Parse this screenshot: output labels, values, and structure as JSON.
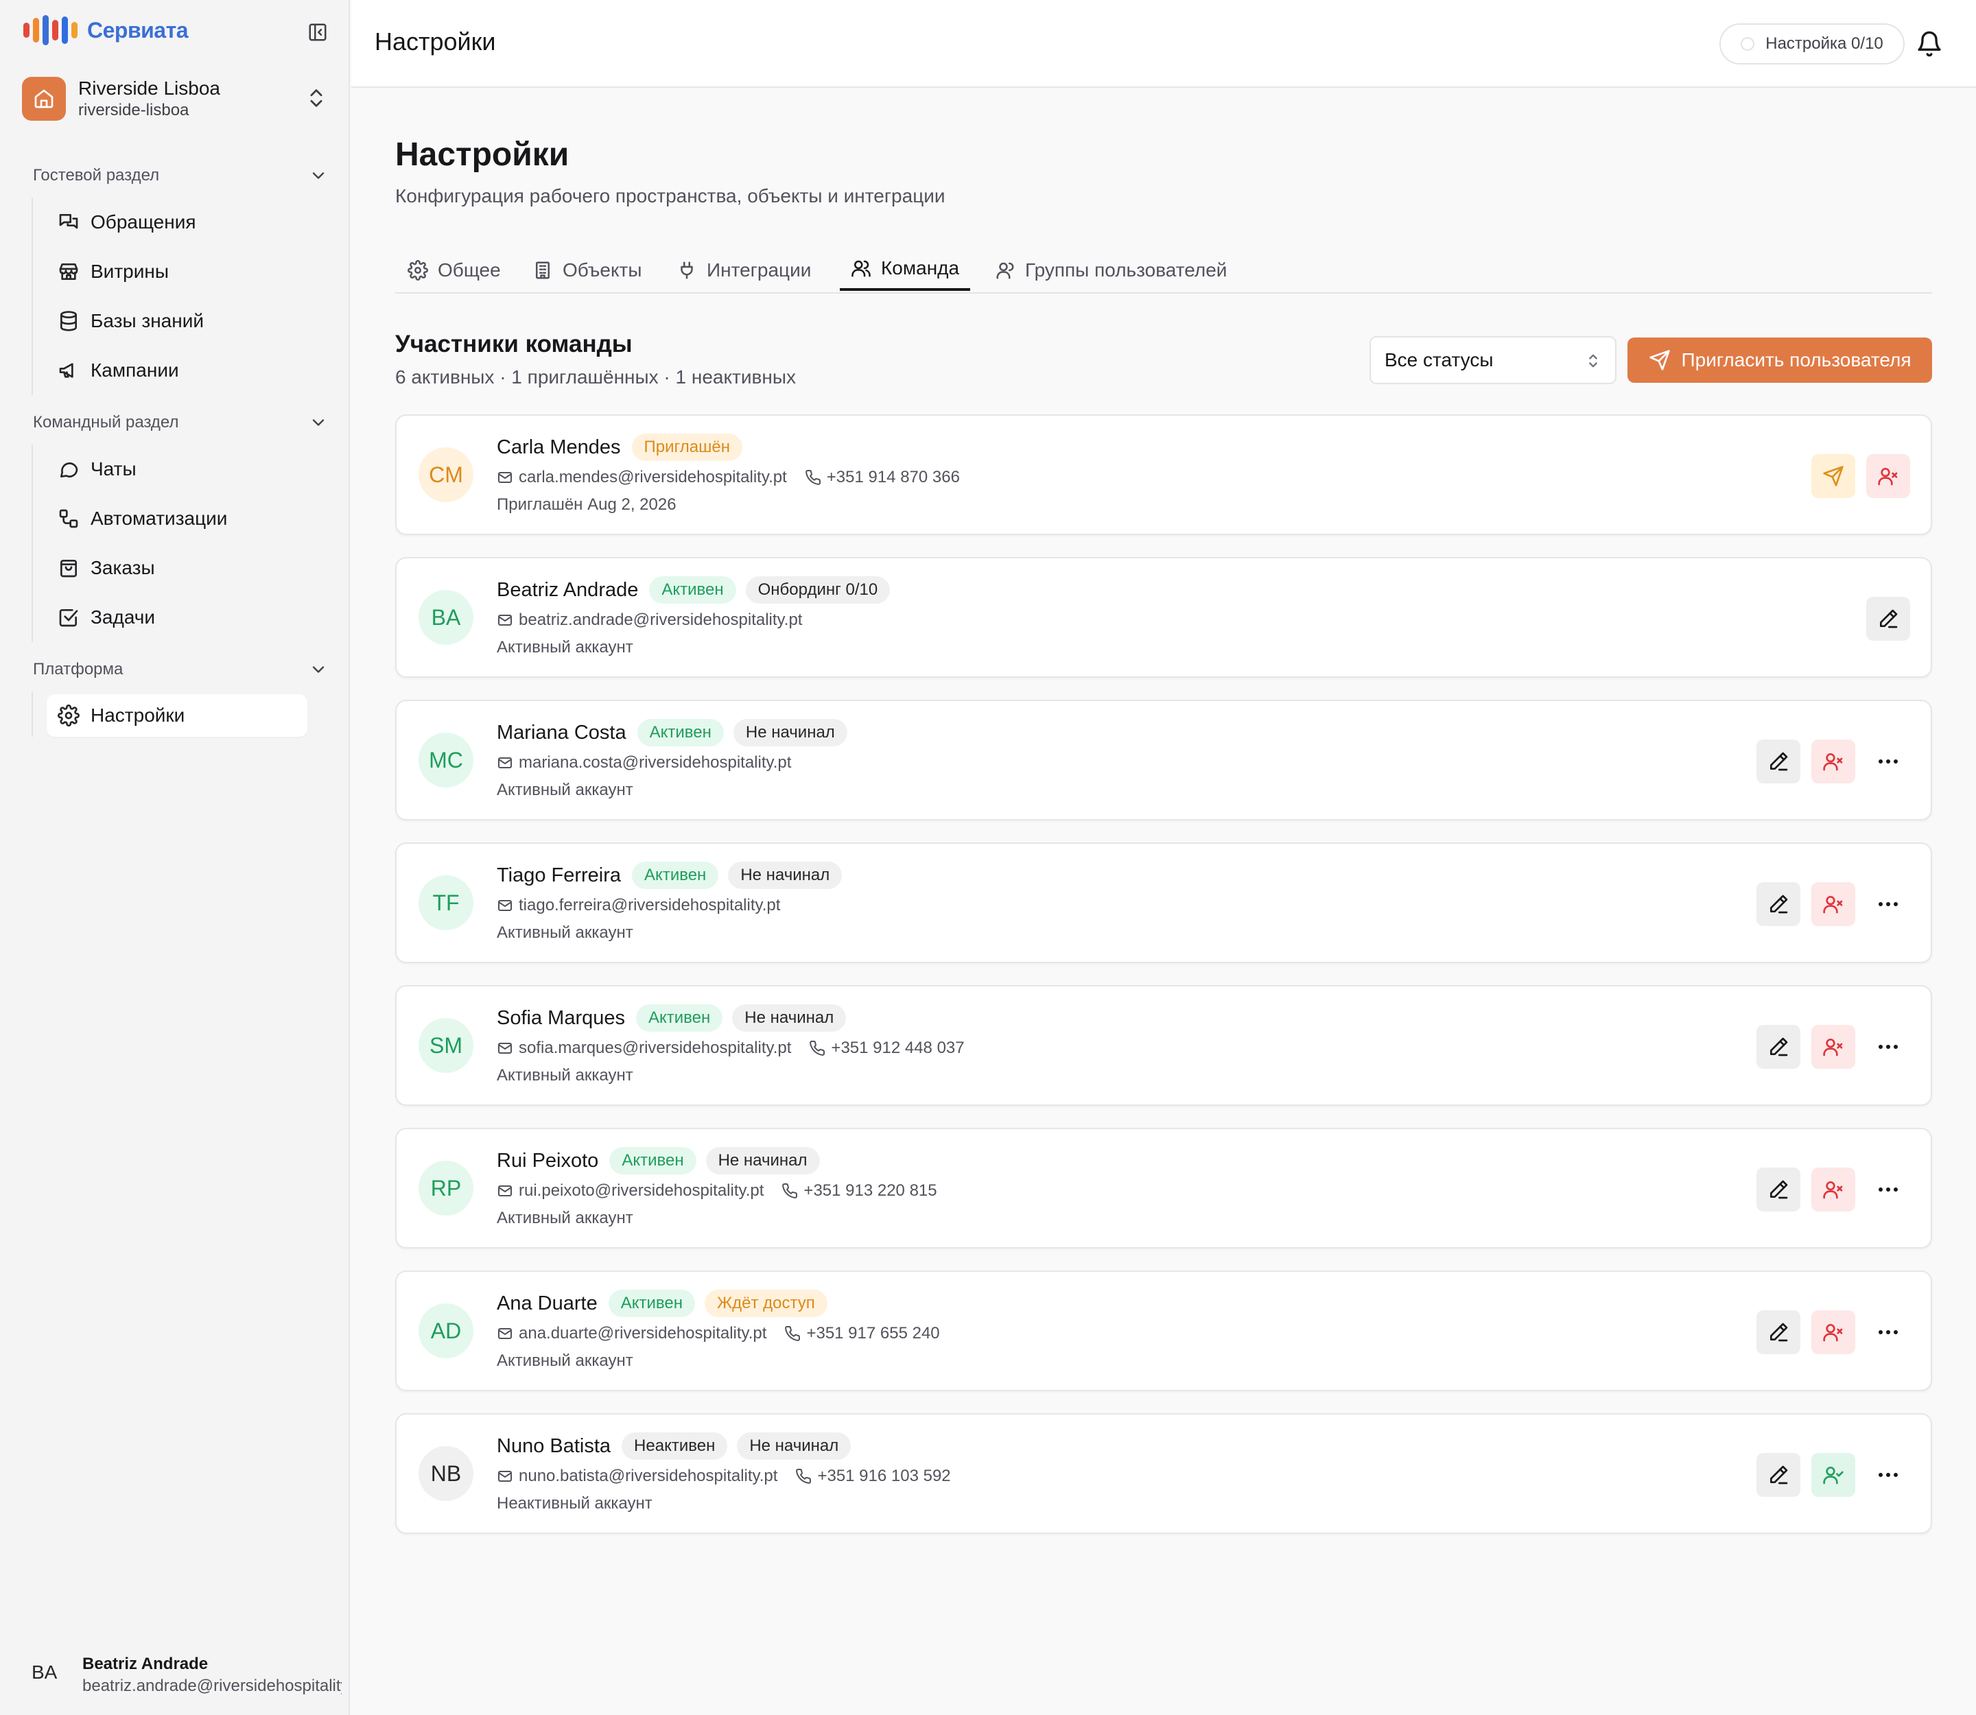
{
  "app": {
    "brand": "Сервиата",
    "brand_colors": [
      "#e24a3b",
      "#f28a2c",
      "#3b6fd6",
      "#e24a3b",
      "#2f6ee0",
      "#f0a030"
    ]
  },
  "workspace": {
    "name": "Riverside Lisboa",
    "slug": "riverside-lisboa"
  },
  "sidebar": {
    "sections": [
      {
        "title": "Гостевой раздел",
        "items": [
          {
            "label": "Обращения",
            "icon": "messages-icon"
          },
          {
            "label": "Витрины",
            "icon": "store-icon"
          },
          {
            "label": "Базы знаний",
            "icon": "database-icon"
          },
          {
            "label": "Кампании",
            "icon": "megaphone-icon"
          }
        ]
      },
      {
        "title": "Командный раздел",
        "items": [
          {
            "label": "Чаты",
            "icon": "chat-icon"
          },
          {
            "label": "Автоматизации",
            "icon": "workflow-icon"
          },
          {
            "label": "Заказы",
            "icon": "shopping-bag-icon"
          },
          {
            "label": "Задачи",
            "icon": "checkbox-icon"
          }
        ]
      },
      {
        "title": "Платформа",
        "items": [
          {
            "label": "Настройки",
            "icon": "gear-icon",
            "active": true
          }
        ]
      }
    ]
  },
  "user": {
    "initials": "BA",
    "name": "Beatriz Andrade",
    "email": "beatriz.andrade@riversidehospitality.pt"
  },
  "topbar": {
    "title": "Настройки",
    "setup_label": "Настройка 0/10"
  },
  "page": {
    "title": "Настройки",
    "subtitle": "Конфигурация рабочего пространства, объекты и интеграции"
  },
  "tabs": [
    {
      "label": "Общее",
      "icon": "gear-icon"
    },
    {
      "label": "Объекты",
      "icon": "building-icon"
    },
    {
      "label": "Интеграции",
      "icon": "plug-icon"
    },
    {
      "label": "Команда",
      "icon": "users-icon",
      "active": true
    },
    {
      "label": "Группы пользователей",
      "icon": "user-group-icon"
    }
  ],
  "team": {
    "title": "Участники команды",
    "stats": "6 активных · 1 приглашённых · 1 неактивных",
    "filter_value": "Все статусы",
    "invite_label": "Пригласить пользователя"
  },
  "members": [
    {
      "initials": "CM",
      "name": "Carla Mendes",
      "badges": [
        {
          "text": "Приглашён",
          "tone": "orange"
        }
      ],
      "email": "carla.mendes@riversidehospitality.pt",
      "phone": "+351 914 870 366",
      "note": "Приглашён Aug 2, 2026",
      "actions": [
        "resend",
        "remove"
      ],
      "avatar_bg": "#fff1dc",
      "avatar_fg": "#dc8a1a"
    },
    {
      "initials": "BA",
      "name": "Beatriz Andrade",
      "badges": [
        {
          "text": "Активен",
          "tone": "green"
        },
        {
          "text": "Онбординг 0/10",
          "tone": "gray"
        }
      ],
      "email": "beatriz.andrade@riversidehospitality.pt",
      "phone": "",
      "note": "Активный аккаунт",
      "actions": [
        "edit"
      ],
      "avatar_bg": "#e4f8ee",
      "avatar_fg": "#1f9d5b"
    },
    {
      "initials": "MC",
      "name": "Mariana Costa",
      "badges": [
        {
          "text": "Активен",
          "tone": "green"
        },
        {
          "text": "Не начинал",
          "tone": "gray"
        }
      ],
      "email": "mariana.costa@riversidehospitality.pt",
      "phone": "",
      "note": "Активный аккаунт",
      "actions": [
        "edit",
        "remove",
        "more"
      ],
      "avatar_bg": "#e4f8ee",
      "avatar_fg": "#1f9d5b"
    },
    {
      "initials": "TF",
      "name": "Tiago Ferreira",
      "badges": [
        {
          "text": "Активен",
          "tone": "green"
        },
        {
          "text": "Не начинал",
          "tone": "gray"
        }
      ],
      "email": "tiago.ferreira@riversidehospitality.pt",
      "phone": "",
      "note": "Активный аккаунт",
      "actions": [
        "edit",
        "remove",
        "more"
      ],
      "avatar_bg": "#e4f8ee",
      "avatar_fg": "#1f9d5b"
    },
    {
      "initials": "SM",
      "name": "Sofia Marques",
      "badges": [
        {
          "text": "Активен",
          "tone": "green"
        },
        {
          "text": "Не начинал",
          "tone": "gray"
        }
      ],
      "email": "sofia.marques@riversidehospitality.pt",
      "phone": "+351 912 448 037",
      "note": "Активный аккаунт",
      "actions": [
        "edit",
        "remove",
        "more"
      ],
      "avatar_bg": "#e4f8ee",
      "avatar_fg": "#1f9d5b"
    },
    {
      "initials": "RP",
      "name": "Rui Peixoto",
      "badges": [
        {
          "text": "Активен",
          "tone": "green"
        },
        {
          "text": "Не начинал",
          "tone": "gray"
        }
      ],
      "email": "rui.peixoto@riversidehospitality.pt",
      "phone": "+351 913 220 815",
      "note": "Активный аккаунт",
      "actions": [
        "edit",
        "remove",
        "more"
      ],
      "avatar_bg": "#e4f8ee",
      "avatar_fg": "#1f9d5b"
    },
    {
      "initials": "AD",
      "name": "Ana Duarte",
      "badges": [
        {
          "text": "Активен",
          "tone": "green"
        },
        {
          "text": "Ждёт доступ",
          "tone": "orange"
        }
      ],
      "email": "ana.duarte@riversidehospitality.pt",
      "phone": "+351 917 655 240",
      "note": "Активный аккаунт",
      "actions": [
        "edit",
        "remove",
        "more"
      ],
      "avatar_bg": "#e4f8ee",
      "avatar_fg": "#1f9d5b"
    },
    {
      "initials": "NB",
      "name": "Nuno Batista",
      "badges": [
        {
          "text": "Неактивен",
          "tone": "gray"
        },
        {
          "text": "Не начинал",
          "tone": "gray"
        }
      ],
      "email": "nuno.batista@riversidehospitality.pt",
      "phone": "+351 916 103 592",
      "note": "Неактивный аккаунт",
      "actions": [
        "edit",
        "activate",
        "more"
      ],
      "avatar_bg": "#f0f0f1",
      "avatar_fg": "#27272a"
    }
  ]
}
